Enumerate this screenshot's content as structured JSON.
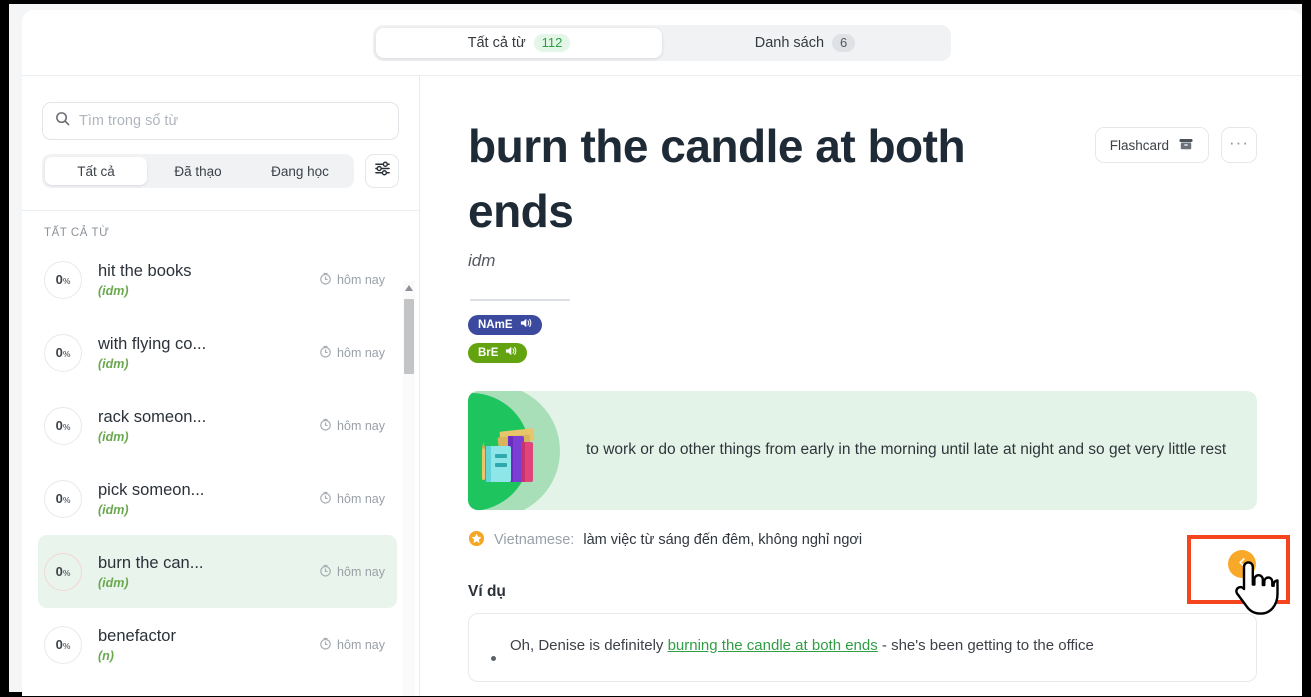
{
  "topbar": {
    "tabs": [
      {
        "label": "Tất cả từ",
        "badge": "112",
        "active": true
      },
      {
        "label": "Danh sách",
        "badge": "6",
        "active": false
      }
    ]
  },
  "sidebar": {
    "search": {
      "placeholder": "Tìm trong sổ từ",
      "value": "",
      "icon": "search-icon"
    },
    "filters": [
      {
        "label": "Tất cả",
        "active": true
      },
      {
        "label": "Đã thạo",
        "active": false
      },
      {
        "label": "Đang học",
        "active": false
      }
    ],
    "settings_icon": "sliders-icon",
    "list_header": "TẤT CẢ TỪ",
    "items": [
      {
        "progress": "0",
        "percent": "%",
        "term": "hit the books",
        "pos": "(idm)",
        "time": "hôm nay",
        "active": false
      },
      {
        "progress": "0",
        "percent": "%",
        "term": "with flying co...",
        "pos": "(idm)",
        "time": "hôm nay",
        "active": false
      },
      {
        "progress": "0",
        "percent": "%",
        "term": "rack someon...",
        "pos": "(idm)",
        "time": "hôm nay",
        "active": false
      },
      {
        "progress": "0",
        "percent": "%",
        "term": "pick someon...",
        "pos": "(idm)",
        "time": "hôm nay",
        "active": false
      },
      {
        "progress": "0",
        "percent": "%",
        "term": "burn the can...",
        "pos": "(idm)",
        "time": "hôm nay",
        "active": true
      },
      {
        "progress": "0",
        "percent": "%",
        "term": "benefactor",
        "pos": "(n)",
        "time": "hôm nay",
        "active": false
      }
    ]
  },
  "entry": {
    "title": "burn the candle at both ends",
    "pos": "idm",
    "flashcard_label": "Flashcard",
    "flashcard_icon": "flashcard-icon",
    "more_label": "···",
    "pronunciations": [
      {
        "label": "NAmE",
        "color": "#3b4a9e",
        "icon": "speaker-icon"
      },
      {
        "label": "BrE",
        "color": "#62a30f",
        "icon": "speaker-icon"
      }
    ],
    "definition": "to work or do other things from early in the morning until late at night and so get very little rest",
    "definition_illustration": "books-illustration",
    "translation": {
      "star_icon": "star-icon",
      "label": "Vietnamese:",
      "value": "làm việc từ sáng đến đêm, không nghỉ ngơi"
    },
    "examples_heading": "Ví dụ",
    "examples": [
      {
        "before": "Oh, Denise is definitely ",
        "highlight": "burning the candle at both ends",
        "after": " - she's been getting to the office"
      }
    ]
  },
  "annotation": {
    "button_icon": "chevron-left-icon",
    "cursor_icon": "hand-pointer-cursor",
    "highlight_color": "#f4451f",
    "button_color": "#f8a92a"
  }
}
